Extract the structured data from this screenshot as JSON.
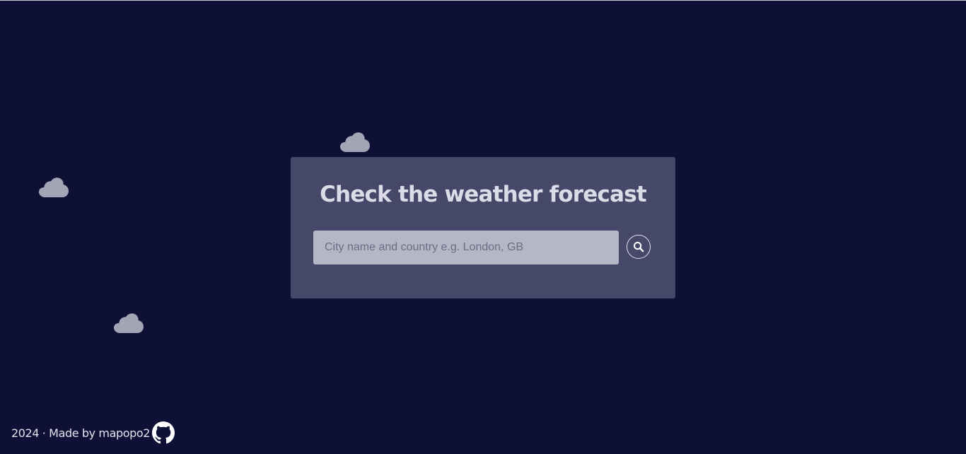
{
  "main": {
    "title": "Check the weather forecast",
    "search": {
      "placeholder": "City name and country e.g. London, GB",
      "value": ""
    },
    "search_button_icon": "search-icon"
  },
  "footer": {
    "text": "2024 · Made by mapopo2",
    "link_icon": "github-icon"
  },
  "decorations": {
    "cloud_icon": "cloud-icon",
    "cloud_color": "#a3a5b7"
  },
  "colors": {
    "background": "#0e1036",
    "card": "#464869",
    "input": "#b5b7c6",
    "title": "#dcdce8"
  }
}
